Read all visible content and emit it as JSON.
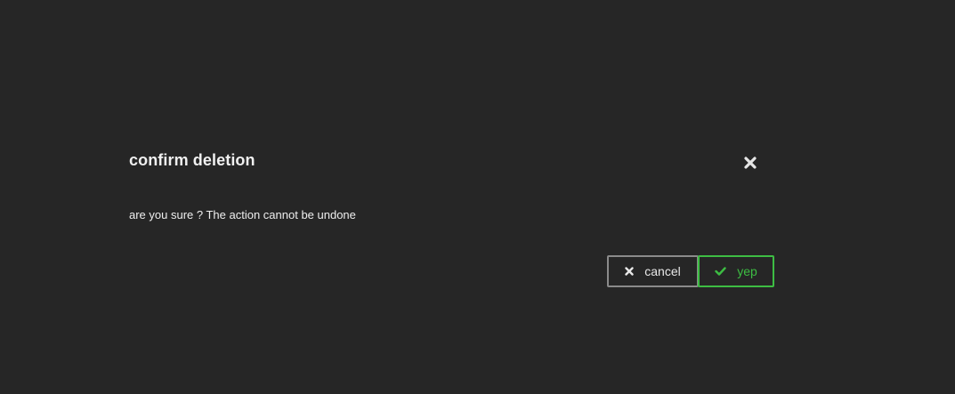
{
  "dialog": {
    "title": "confirm deletion",
    "message": "are you sure ? The action cannot be undone",
    "close_icon": "close-icon",
    "cancel_label": "cancel",
    "cancel_icon": "x-icon",
    "confirm_label": "yep",
    "confirm_icon": "check-icon"
  },
  "colors": {
    "background": "#262626",
    "text": "#f0f0f0",
    "cancel_border": "#8a8a8a",
    "confirm_accent": "#3dbd43"
  }
}
